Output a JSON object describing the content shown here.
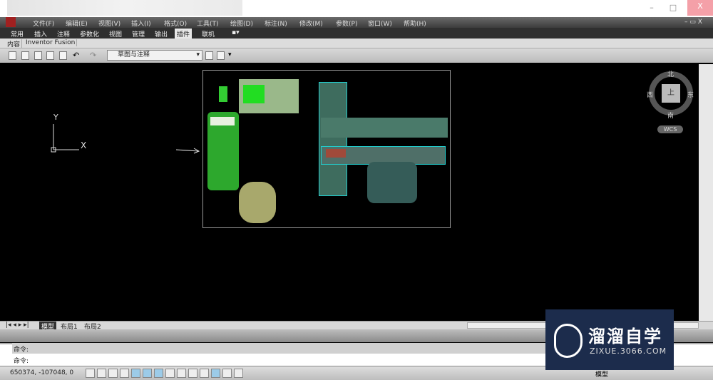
{
  "window": {
    "minimize": "–",
    "maximize": "□",
    "close": "X",
    "doc_controls": "–  ▭ X"
  },
  "menu": [
    "文件(F)",
    "编辑(E)",
    "视图(V)",
    "插入(I)",
    "格式(O)",
    "工具(T)",
    "绘图(D)",
    "标注(N)",
    "修改(M)",
    "参数(P)",
    "窗口(W)",
    "帮助(H)"
  ],
  "ribbon_tabs": [
    "常用",
    "插入",
    "注释",
    "参数化",
    "视图",
    "管理",
    "输出",
    "插件",
    "联机"
  ],
  "active_ribbon_tab": "插件",
  "panel_tabs": [
    "内容",
    "Inventor Fusion"
  ],
  "workspace": "草图与注释",
  "ucs": {
    "x": "X",
    "y": "Y"
  },
  "viewcube": {
    "north": "北",
    "south": "南",
    "east": "东",
    "west": "西",
    "top": "上",
    "wcs": "WCS"
  },
  "layout_tabs": [
    "模型",
    "布局1",
    "布局2"
  ],
  "active_layout": "模型",
  "command": {
    "history": "命令:",
    "prompt": "命令:"
  },
  "status": {
    "coords": "650374, -107048, 0",
    "model": "模型"
  },
  "watermark": {
    "title": "溜溜自学",
    "url": "ZIXUE.3066.COM"
  }
}
